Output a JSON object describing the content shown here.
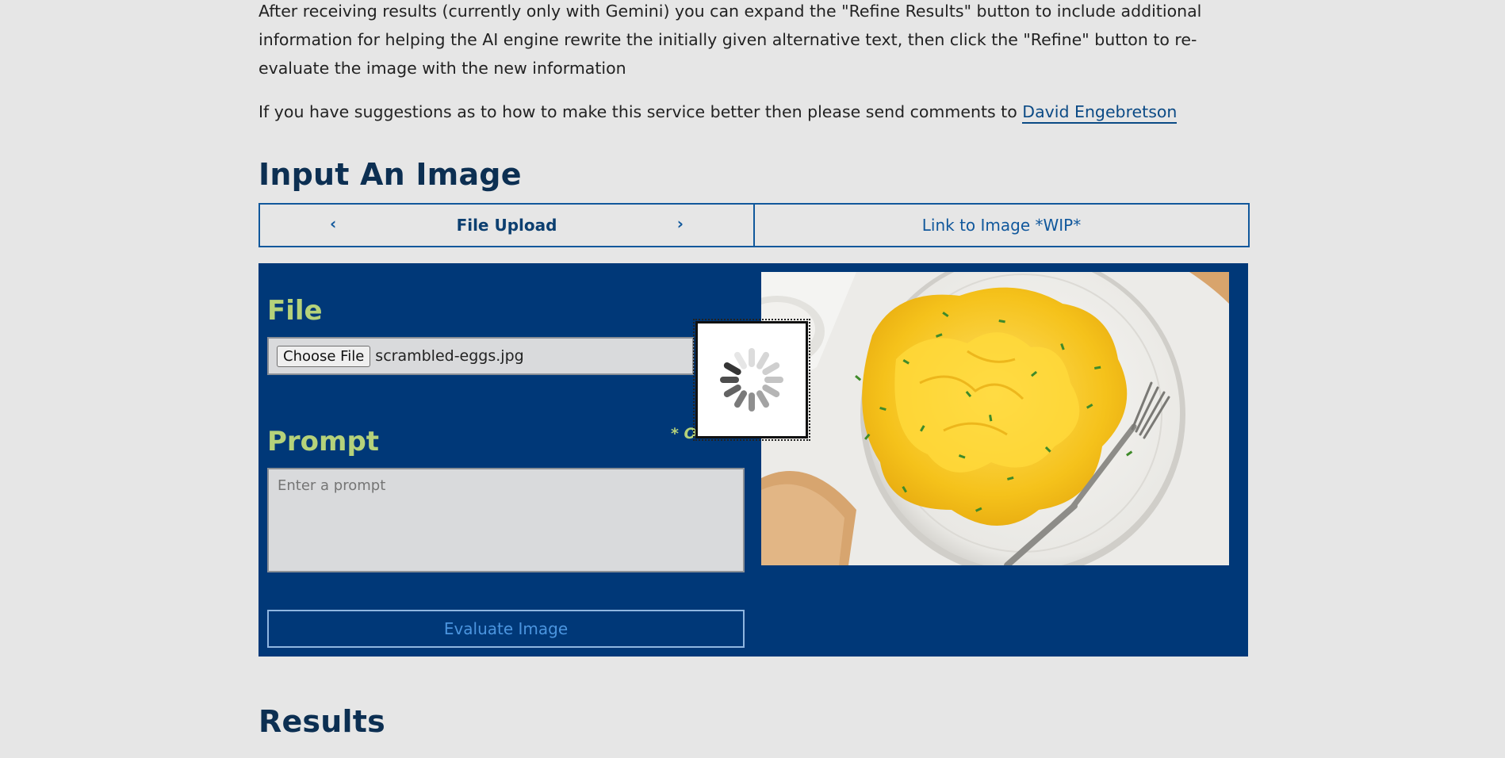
{
  "intro": {
    "text": "After receiving results (currently only with Gemini) you can expand the \"Refine Results\" button to include additional information for helping the AI engine rewrite the initially given alternative text, then click the \"Refine\" button to re-evaluate the image with the new information"
  },
  "suggestions": {
    "text_before": "If you have suggestions as to how to make this service better then please send comments to ",
    "contact_name": "David Engebretson"
  },
  "input_section": {
    "heading": "Input An Image",
    "tabs": [
      {
        "label": "File Upload",
        "active": true
      },
      {
        "label": "Link to Image *WIP*",
        "active": false
      }
    ]
  },
  "form": {
    "file_label": "File",
    "choose_file_label": "Choose File",
    "selected_file": "scrambled-eggs.jpg",
    "prompt_label": "Prompt",
    "optional_tag": "* O",
    "prompt_placeholder": "Enter a prompt",
    "prompt_value": "",
    "evaluate_label": "Evaluate Image"
  },
  "preview": {
    "subject": "scrambled eggs on a white plate with chives and a fork"
  },
  "colors": {
    "panel_bg": "#003878",
    "label_green": "#b5d27a",
    "link_blue": "#0b4a85",
    "heading_navy": "#0c2f52"
  },
  "results_section": {
    "heading": "Results"
  }
}
